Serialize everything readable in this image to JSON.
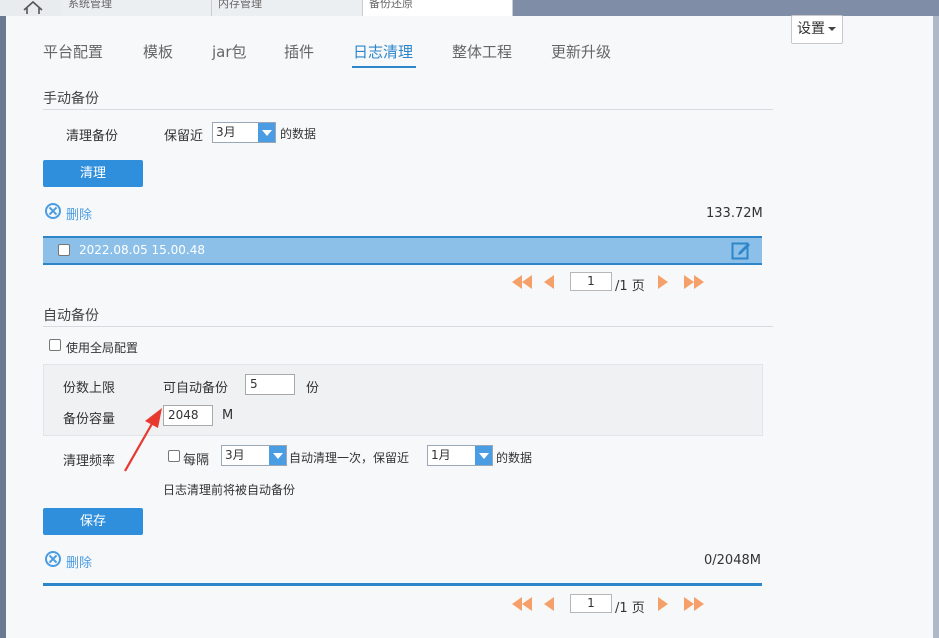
{
  "top_tabs": [
    "系统管理",
    "内存管理",
    "备份还原"
  ],
  "settings_label": "设置",
  "nav": [
    "平台配置",
    "模板",
    "jar包",
    "插件",
    "日志清理",
    "整体工程",
    "更新升级"
  ],
  "manual": {
    "title": "手动备份",
    "clean_label": "清理备份",
    "keep_label": "保留近",
    "keep_value": "3月",
    "keep_suffix": "的数据",
    "clean_button": "清理",
    "delete_label": "删除",
    "size": "133.72M",
    "row_text": "2022.08.05 15.00.48",
    "page_value": "1",
    "page_total": "/1 页"
  },
  "auto": {
    "title": "自动备份",
    "use_global": "使用全局配置",
    "count_label": "份数上限",
    "count_prefix": "可自动备份",
    "count_value": "5",
    "count_unit": "份",
    "capacity_label": "备份容量",
    "capacity_value": "2048",
    "capacity_unit": "M",
    "freq_label": "清理频率",
    "every_label": "每隔",
    "every_value": "3月",
    "auto_clean_text": "自动清理一次，保留近",
    "keep_value": "1月",
    "keep_suffix": "的数据",
    "note": "日志清理前将被自动备份",
    "save_button": "保存",
    "delete_label": "删除",
    "size": "0/2048M",
    "page_value": "1",
    "page_total": "/1 页"
  },
  "colors": {
    "accent": "#2c86c9",
    "button": "#2f8fdc",
    "pager": "#f5a06a",
    "arrow_annotation": "#e8392f"
  }
}
